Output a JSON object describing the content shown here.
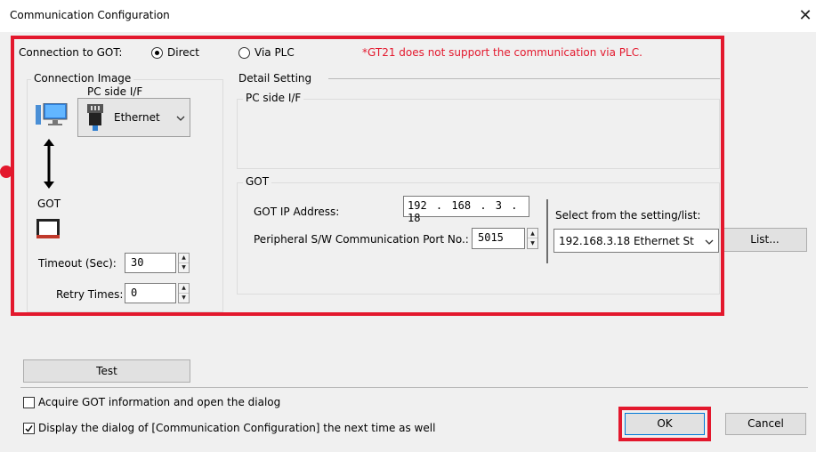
{
  "window": {
    "title": "Communication Configuration",
    "close_glyph": "✕"
  },
  "connection": {
    "label": "Connection to GOT:",
    "direct_label": "Direct",
    "via_plc_label": "Via PLC",
    "selected": "Direct",
    "warning": "*GT21 does not support the communication via PLC.",
    "warning_color": "#e3182d"
  },
  "connection_image": {
    "group_label": "Connection Image",
    "pc_side_label": "PC side I/F",
    "interface_value": "Ethernet",
    "got_label": "GOT",
    "timeout_label": "Timeout (Sec):",
    "timeout_value": "30",
    "retry_label": "Retry Times:",
    "retry_value": "0"
  },
  "detail": {
    "group_label": "Detail Setting",
    "pc_side_group": "PC side I/F",
    "got_group": "GOT",
    "ip_label": "GOT IP Address:",
    "ip_octets": [
      "192",
      "168",
      "3",
      "18"
    ],
    "port_label": "Peripheral S/W Communication Port No.:",
    "port_value": "5015",
    "select_label": "Select from the setting/list:",
    "select_value": "192.168.3.18 Ethernet St",
    "list_button": "List..."
  },
  "footer": {
    "test_button": "Test",
    "acquire_label": "Acquire GOT information and open the dialog",
    "acquire_checked": false,
    "display_label": "Display the dialog of [Communication Configuration] the next time as well",
    "display_checked": true,
    "ok_button": "OK",
    "cancel_button": "Cancel"
  },
  "colors": {
    "highlight": "#e3182d",
    "dialog_bg": "#f0f0f0"
  }
}
